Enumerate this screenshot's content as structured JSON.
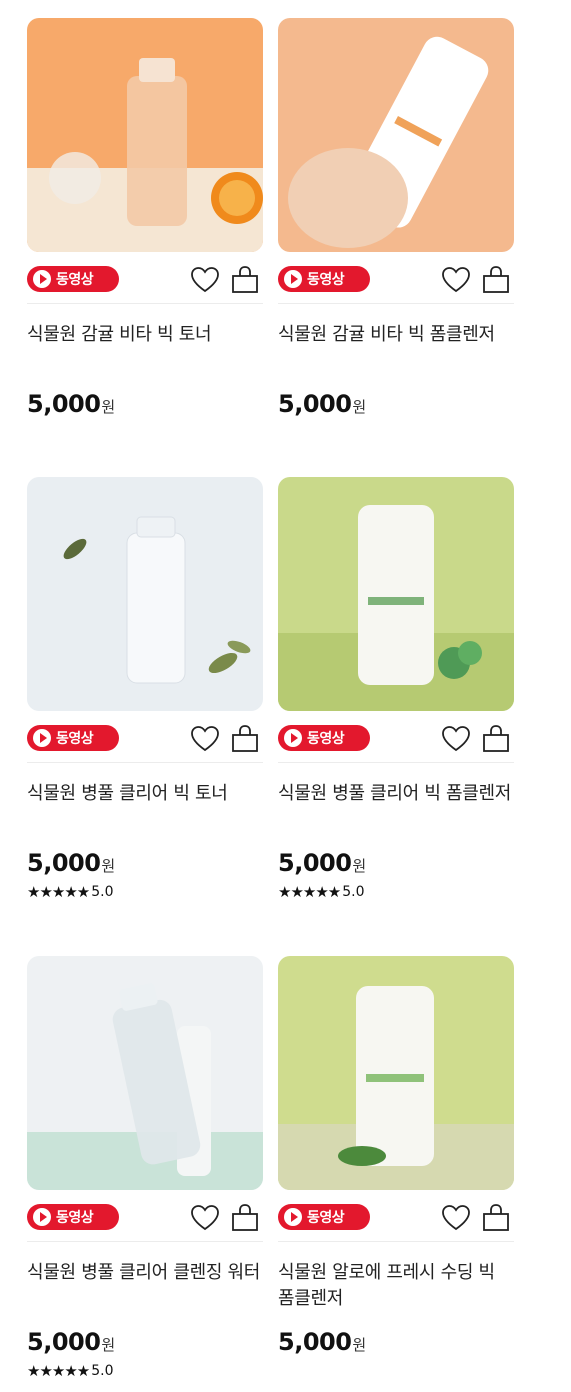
{
  "colors": {
    "badge": "#e3182d",
    "text": "#222222"
  },
  "video_badge_label": "동영상",
  "currency": "원",
  "products": [
    {
      "name": "식물원 감귤 비타 빅 토너",
      "price": "5,000",
      "stars": "",
      "rating": ""
    },
    {
      "name": "식물원 감귤 비타 빅 폼클렌저",
      "price": "5,000",
      "stars": "",
      "rating": ""
    },
    {
      "name": "식물원 병풀 클리어 빅 토너",
      "price": "5,000",
      "stars": "★★★★★",
      "rating": "5.0"
    },
    {
      "name": "식물원 병풀 클리어 빅 폼클렌저",
      "price": "5,000",
      "stars": "★★★★★",
      "rating": "5.0"
    },
    {
      "name": "식물원 병풀 클리어 클렌징 워터",
      "price": "5,000",
      "stars": "★★★★★",
      "rating": "5.0"
    },
    {
      "name": "식물원 알로에 프레시 수딩 빅 폼클렌저",
      "price": "5,000",
      "stars": "",
      "rating": ""
    }
  ],
  "icons": {
    "video": "play-icon",
    "wishlist": "heart-icon",
    "cart": "shopping-bag-icon"
  }
}
